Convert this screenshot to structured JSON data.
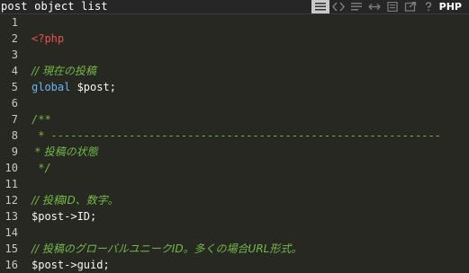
{
  "header": {
    "title": "post object list",
    "language": "PHP",
    "tools": [
      {
        "name": "view-lines-icon",
        "active": true
      },
      {
        "name": "code-icon",
        "active": false
      },
      {
        "name": "wrap-icon",
        "active": false
      },
      {
        "name": "expand-icon",
        "active": false
      },
      {
        "name": "document-icon",
        "active": false
      },
      {
        "name": "external-link-icon",
        "active": false
      },
      {
        "name": "help-icon",
        "active": false
      }
    ]
  },
  "code": {
    "lines": [
      {
        "num": "1",
        "text": "",
        "style": "plain"
      },
      {
        "num": "2",
        "text": "<?php",
        "style": "red"
      },
      {
        "num": "3",
        "text": "",
        "style": "plain"
      },
      {
        "num": "4",
        "text": "// 現在の投稿",
        "style": "comment"
      },
      {
        "num": "5",
        "text": "global $post;",
        "style": "global"
      },
      {
        "num": "6",
        "text": "",
        "style": "plain"
      },
      {
        "num": "7",
        "text": "/**",
        "style": "comment"
      },
      {
        "num": "8",
        "text": " * ------------------------------------------------------------",
        "style": "comment"
      },
      {
        "num": "9",
        "text": " * 投稿の状態",
        "style": "comment"
      },
      {
        "num": "10",
        "text": " */",
        "style": "comment"
      },
      {
        "num": "11",
        "text": "",
        "style": "plain"
      },
      {
        "num": "12",
        "text": "// 投稿ID、数字。",
        "style": "comment"
      },
      {
        "num": "13",
        "text": "$post->ID;",
        "style": "plain"
      },
      {
        "num": "14",
        "text": "",
        "style": "plain"
      },
      {
        "num": "15",
        "text": "// 投稿のグローバルユニークID。多くの場合URL形式。",
        "style": "comment"
      },
      {
        "num": "16",
        "text": "$post->guid;",
        "style": "plain"
      }
    ]
  },
  "colors": {
    "background": "#272822",
    "keyword": "#66b8ef",
    "comment": "#74b84a",
    "php_tag": "#e8524b",
    "text": "#f8f8f2"
  }
}
